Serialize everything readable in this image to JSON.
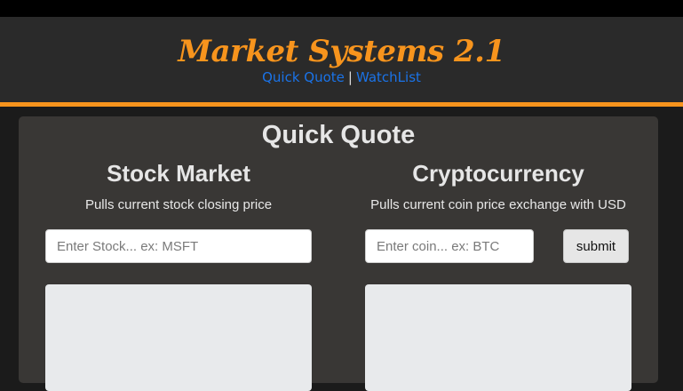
{
  "header": {
    "title": "Market Systems 2.1",
    "nav": {
      "quick_quote": "Quick Quote",
      "separator": "|",
      "watchlist": "WatchList"
    }
  },
  "main": {
    "title": "Quick Quote",
    "stock": {
      "heading": "Stock Market",
      "description": "Pulls current stock closing price",
      "input_placeholder": "Enter Stock... ex: MSFT"
    },
    "crypto": {
      "heading": "Cryptocurrency",
      "description": "Pulls current coin price exchange with USD",
      "input_placeholder": "Enter coin... ex: BTC",
      "submit_label": "submit"
    }
  },
  "colors": {
    "accent": "#f7941d",
    "link": "#1a73e8",
    "panel": "#393735",
    "header": "#2a2a2a"
  }
}
